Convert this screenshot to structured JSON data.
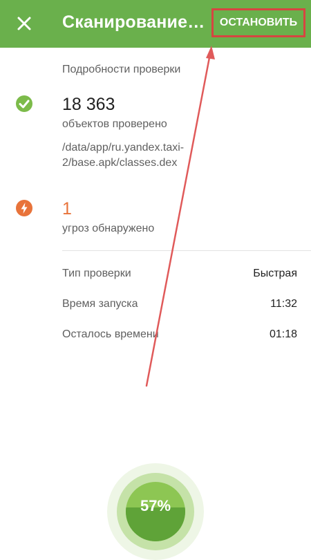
{
  "appbar": {
    "title": "Сканирование…",
    "stop_label": "ОСТАНОВИТЬ",
    "close_icon": "close-icon",
    "color": "#6ab04c"
  },
  "details": {
    "section_title": "Подробности проверки",
    "scanned_count": "18 363",
    "scanned_label": "объектов проверено",
    "current_path": "/data/app/ru.yandex.taxi-2/base.apk/classes.dex",
    "threat_count": "1",
    "threat_label": "угроз обнаружено",
    "check_icon": "check-circle-icon",
    "threat_icon": "bolt-icon"
  },
  "info_rows": [
    {
      "label": "Тип проверки",
      "value": "Быстрая"
    },
    {
      "label": "Время запуска",
      "value": "11:32"
    },
    {
      "label": "Осталось времени",
      "value": "01:18"
    }
  ],
  "progress": {
    "percent_label": "57%",
    "fraction": 0.57
  },
  "colors": {
    "accent": "#6ab04c",
    "warning": "#e8733a",
    "highlight": "#d64541"
  }
}
